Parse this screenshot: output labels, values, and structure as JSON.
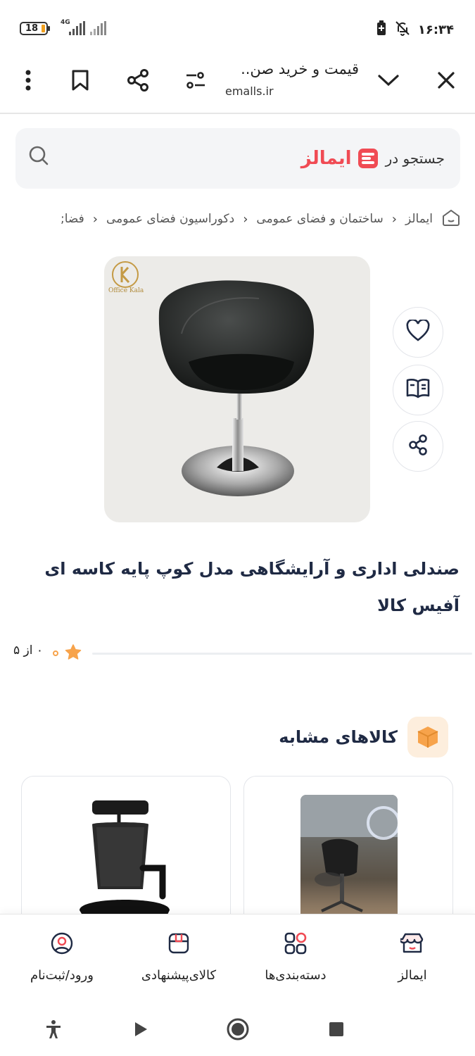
{
  "status_bar": {
    "battery": "18",
    "network": "4G",
    "time": "۱۶:۳۴"
  },
  "browser": {
    "page_title": "قیمت و خرید صن..",
    "host": "emalls.ir"
  },
  "search": {
    "placeholder": "جستجو در",
    "brand": "ایمالز"
  },
  "breadcrumb": [
    "ایمالز",
    "ساختمان و فضای عمومی",
    "دکوراسیون فضای عمومی",
    "فضا;"
  ],
  "product": {
    "logo_text": "Office Kala",
    "title": "صندلی اداری و آرایشگاهی مدل کوپ پایه کاسه ای آفیس کالا",
    "rating_text": "۰ از ۵"
  },
  "similar": {
    "title": "کالاهای مشابه"
  },
  "bottom_nav": [
    {
      "label": "ایمالز",
      "icon": "store-icon"
    },
    {
      "label": "دسته‌بندی‌ها",
      "icon": "categories-icon"
    },
    {
      "label": "کالای‌پیشنهادی",
      "icon": "box-icon"
    },
    {
      "label": "ورود/ثبت‌نام",
      "icon": "user-icon"
    }
  ],
  "colors": {
    "brand": "#f04b54",
    "accent": "#f7a34b",
    "title": "#1f2a44"
  }
}
